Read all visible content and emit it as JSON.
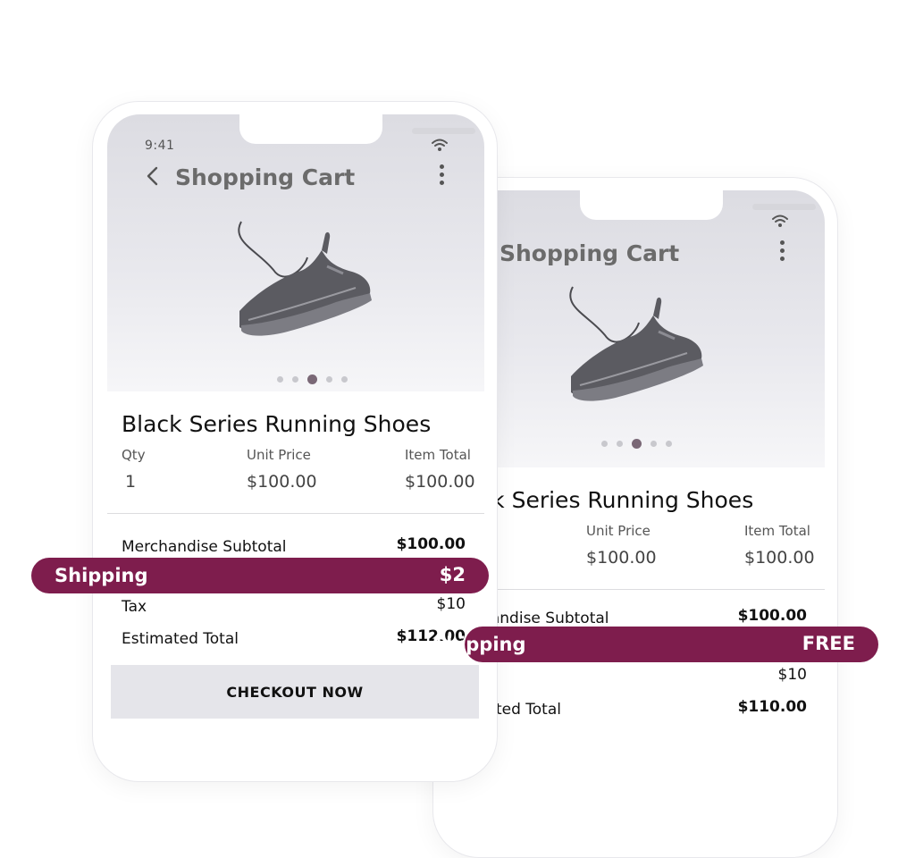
{
  "status_bar": {
    "time": "9:41"
  },
  "header": {
    "title": "Shopping Cart"
  },
  "product": {
    "name": "Black Series Running Shoes",
    "carousel": {
      "count": 5,
      "active_index": 2
    }
  },
  "columns": {
    "qty": "Qty",
    "unit_price": "Unit Price",
    "item_total": "Item Total"
  },
  "item": {
    "qty": "1",
    "unit_price": "$100.00",
    "item_total": "$100.00"
  },
  "front": {
    "summary": {
      "merchandise_subtotal_label": "Merchandise Subtotal",
      "merchandise_subtotal": "$100.00",
      "tax_label": "Tax",
      "tax": "$10",
      "estimated_total_label": "Estimated Total",
      "estimated_total": "$112.00"
    },
    "shipping": {
      "label": "Shipping",
      "value": "$2"
    },
    "checkout_label": "CHECKOUT NOW"
  },
  "back": {
    "summary": {
      "merchandise_subtotal_label": "Merchandise Subtotal",
      "merchandise_subtotal": "$100.00",
      "tax": "$10",
      "estimated_total_label": "Estimated Total",
      "estimated_total": "$110.00"
    },
    "shipping": {
      "label": "Shipping",
      "value": "FREE"
    }
  },
  "colors": {
    "accent": "#7e1d4d",
    "dot_active": "#7a6876",
    "title_gray": "#6b6b6b"
  },
  "icons": [
    "back-chevron-icon",
    "wifi-icon",
    "more-vertical-icon",
    "shoe-image"
  ]
}
